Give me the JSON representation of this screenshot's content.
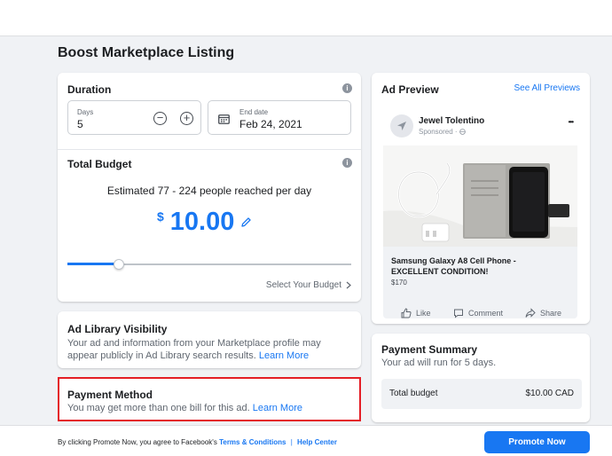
{
  "page": {
    "title": "Boost Marketplace Listing"
  },
  "duration": {
    "title": "Duration",
    "days_label": "Days",
    "days_value": "5",
    "end_date_label": "End date",
    "end_date_value": "Feb 24, 2021",
    "minus_symbol": "−",
    "plus_symbol": "+"
  },
  "budget": {
    "title": "Total Budget",
    "reach_text": "Estimated 77 - 224 people reached per day",
    "currency_symbol": "$",
    "amount": "10.00",
    "slider_level_percent": 18,
    "select_budget_label": "Select Your Budget"
  },
  "ad_library": {
    "title": "Ad Library Visibility",
    "description": "Your ad and information from your Marketplace profile may appear publicly in Ad Library search results.",
    "learn_more": "Learn More"
  },
  "payment_method": {
    "title": "Payment Method",
    "description": "You may get more than one bill for this ad.",
    "learn_more": "Learn More",
    "highlight_color": "#e41e26"
  },
  "ad_preview": {
    "title": "Ad Preview",
    "see_all": "See All Previews",
    "page_name": "Jewel Tolentino",
    "sponsored": "Sponsored ·",
    "more_icon": "•••",
    "listing_title": "Samsung Galaxy A8 Cell Phone - EXCELLENT CONDITION!",
    "price": "$170",
    "actions": {
      "like": "Like",
      "comment": "Comment",
      "share": "Share"
    }
  },
  "payment_summary": {
    "title": "Payment Summary",
    "subtitle": "Your ad will run for 5 days.",
    "total_label": "Total budget",
    "total_value": "$10.00 CAD"
  },
  "footer": {
    "terms_prefix": "By clicking Promote Now, you agree to Facebook's",
    "terms_link": "Terms & Conditions",
    "separator": "|",
    "help_link": "Help Center",
    "promote_button": "Promote Now"
  },
  "colors": {
    "brand_blue": "#1877f2",
    "background": "#f0f2f5"
  }
}
